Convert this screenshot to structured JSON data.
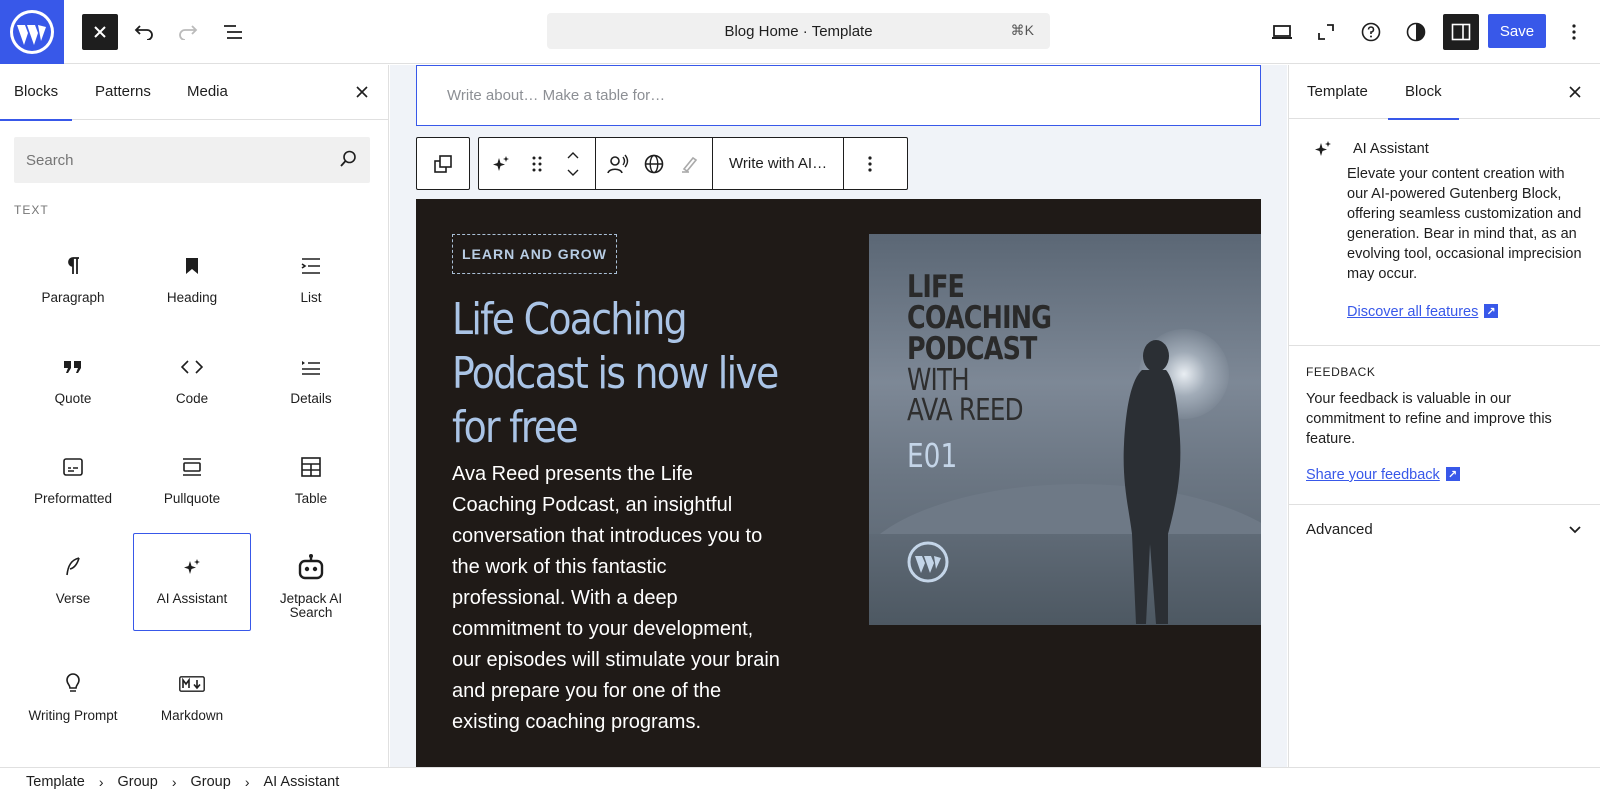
{
  "topbar": {
    "doc_title": "Blog Home · Template",
    "shortcut": "⌘K",
    "save_label": "Save"
  },
  "inserter": {
    "tabs": [
      "Blocks",
      "Patterns",
      "Media"
    ],
    "search_placeholder": "Search",
    "category": "TEXT",
    "blocks": [
      {
        "label": "Paragraph",
        "icon": "paragraph-icon"
      },
      {
        "label": "Heading",
        "icon": "heading-icon"
      },
      {
        "label": "List",
        "icon": "list-icon"
      },
      {
        "label": "Quote",
        "icon": "quote-icon"
      },
      {
        "label": "Code",
        "icon": "code-icon"
      },
      {
        "label": "Details",
        "icon": "details-icon"
      },
      {
        "label": "Preformatted",
        "icon": "preformatted-icon"
      },
      {
        "label": "Pullquote",
        "icon": "pullquote-icon"
      },
      {
        "label": "Table",
        "icon": "table-icon"
      },
      {
        "label": "Verse",
        "icon": "verse-icon"
      },
      {
        "label": "AI Assistant",
        "icon": "sparkles-icon"
      },
      {
        "label": "Jetpack AI Search",
        "icon": "robot-icon"
      },
      {
        "label": "Writing Prompt",
        "icon": "lightbulb-icon"
      },
      {
        "label": "Markdown",
        "icon": "markdown-icon"
      }
    ]
  },
  "editor": {
    "ai_placeholder": "Write about… Make a table for…",
    "write_with_ai": "Write with AI…",
    "tagline": "LEARN AND GROW",
    "title": "Life Coaching Podcast is now live for free",
    "body": "Ava Reed presents the Life Coaching Podcast, an insightful conversation that introduces you to the work of this fantastic professional. With a deep commitment to your development, our episodes will stimulate your brain and prepare you for one of the existing coaching programs.",
    "cover": {
      "line1": "LIFE",
      "line2": "COACHING",
      "line3": "PODCAST",
      "line4": "WITH",
      "line5": "AVA REED",
      "episode": "E01"
    }
  },
  "sidebar": {
    "tabs": [
      "Template",
      "Block"
    ],
    "block_name": "AI Assistant",
    "block_desc": "Elevate your content creation with our AI-powered Gutenberg Block, offering seamless customization and generation. Bear in mind that, as an evolving tool, occasional imprecision may occur.",
    "discover_link": "Discover all features",
    "feedback_heading": "FEEDBACK",
    "feedback_text": "Your feedback is valuable in our commitment to refine and improve this feature.",
    "feedback_link": "Share your feedback",
    "advanced": "Advanced"
  },
  "breadcrumb": [
    "Template",
    "Group",
    "Group",
    "AI Assistant"
  ],
  "colors": {
    "accent": "#3858e9",
    "hero_bg": "#1f1a17",
    "hero_title": "#aac4e6"
  }
}
